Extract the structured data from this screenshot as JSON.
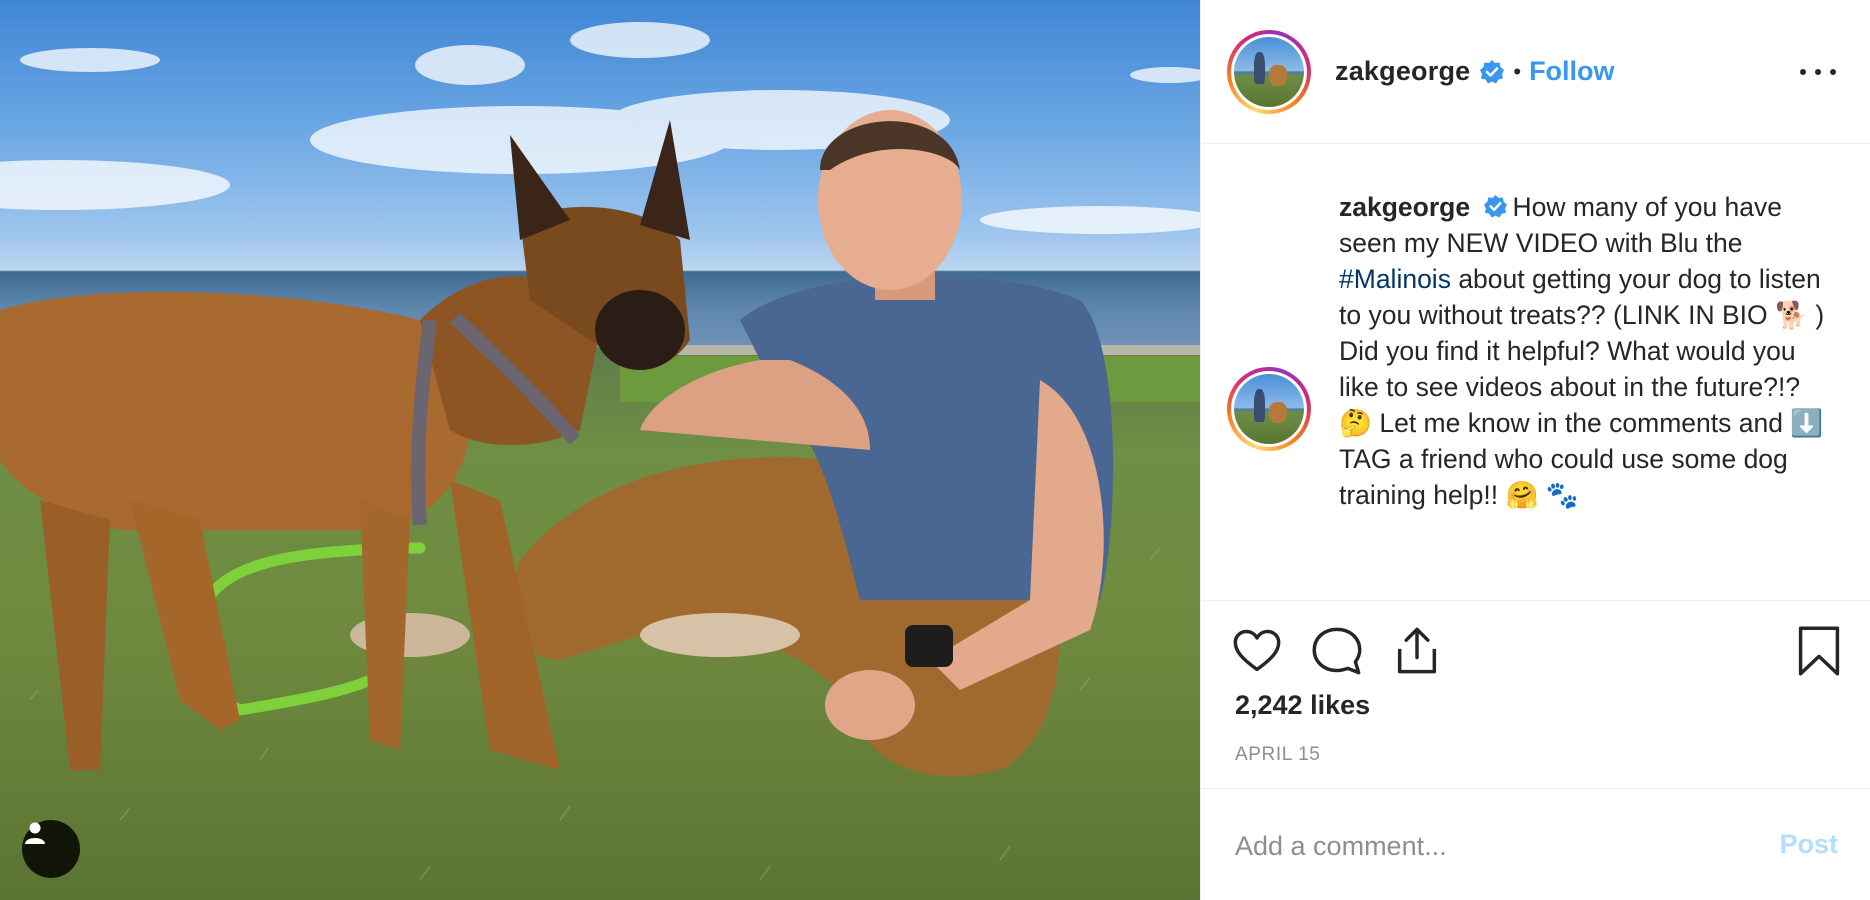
{
  "post": {
    "username": "zakgeorge",
    "dot": "•",
    "follow_label": "Follow",
    "caption": {
      "username": "zakgeorge",
      "text_1": "How many of you have seen my NEW VIDEO with Blu the ",
      "hashtag": "#Malinois",
      "text_2": " about getting your dog to listen to you without treats?? (LINK IN BIO 🐕 ) Did you find it helpful? What would you like to see videos about in the future?!? 🤔  Let me know in the comments and ⬇️  TAG a friend who could use some dog training help!! 🤗 🐾"
    },
    "likes": "2,242 likes",
    "date": "APRIL 15",
    "comment": {
      "placeholder": "Add a comment...",
      "value": "",
      "post_label": "Post"
    }
  },
  "colors": {
    "follow": "#3897f0",
    "hashtag": "#003569",
    "post_disabled": "#b2dffc",
    "verified": "#3897f0",
    "muted": "#8e8e8e"
  },
  "icons": [
    "user-tag-icon",
    "verified-badge-icon",
    "more-options-icon",
    "heart-icon",
    "comment-icon",
    "share-icon",
    "bookmark-icon"
  ]
}
